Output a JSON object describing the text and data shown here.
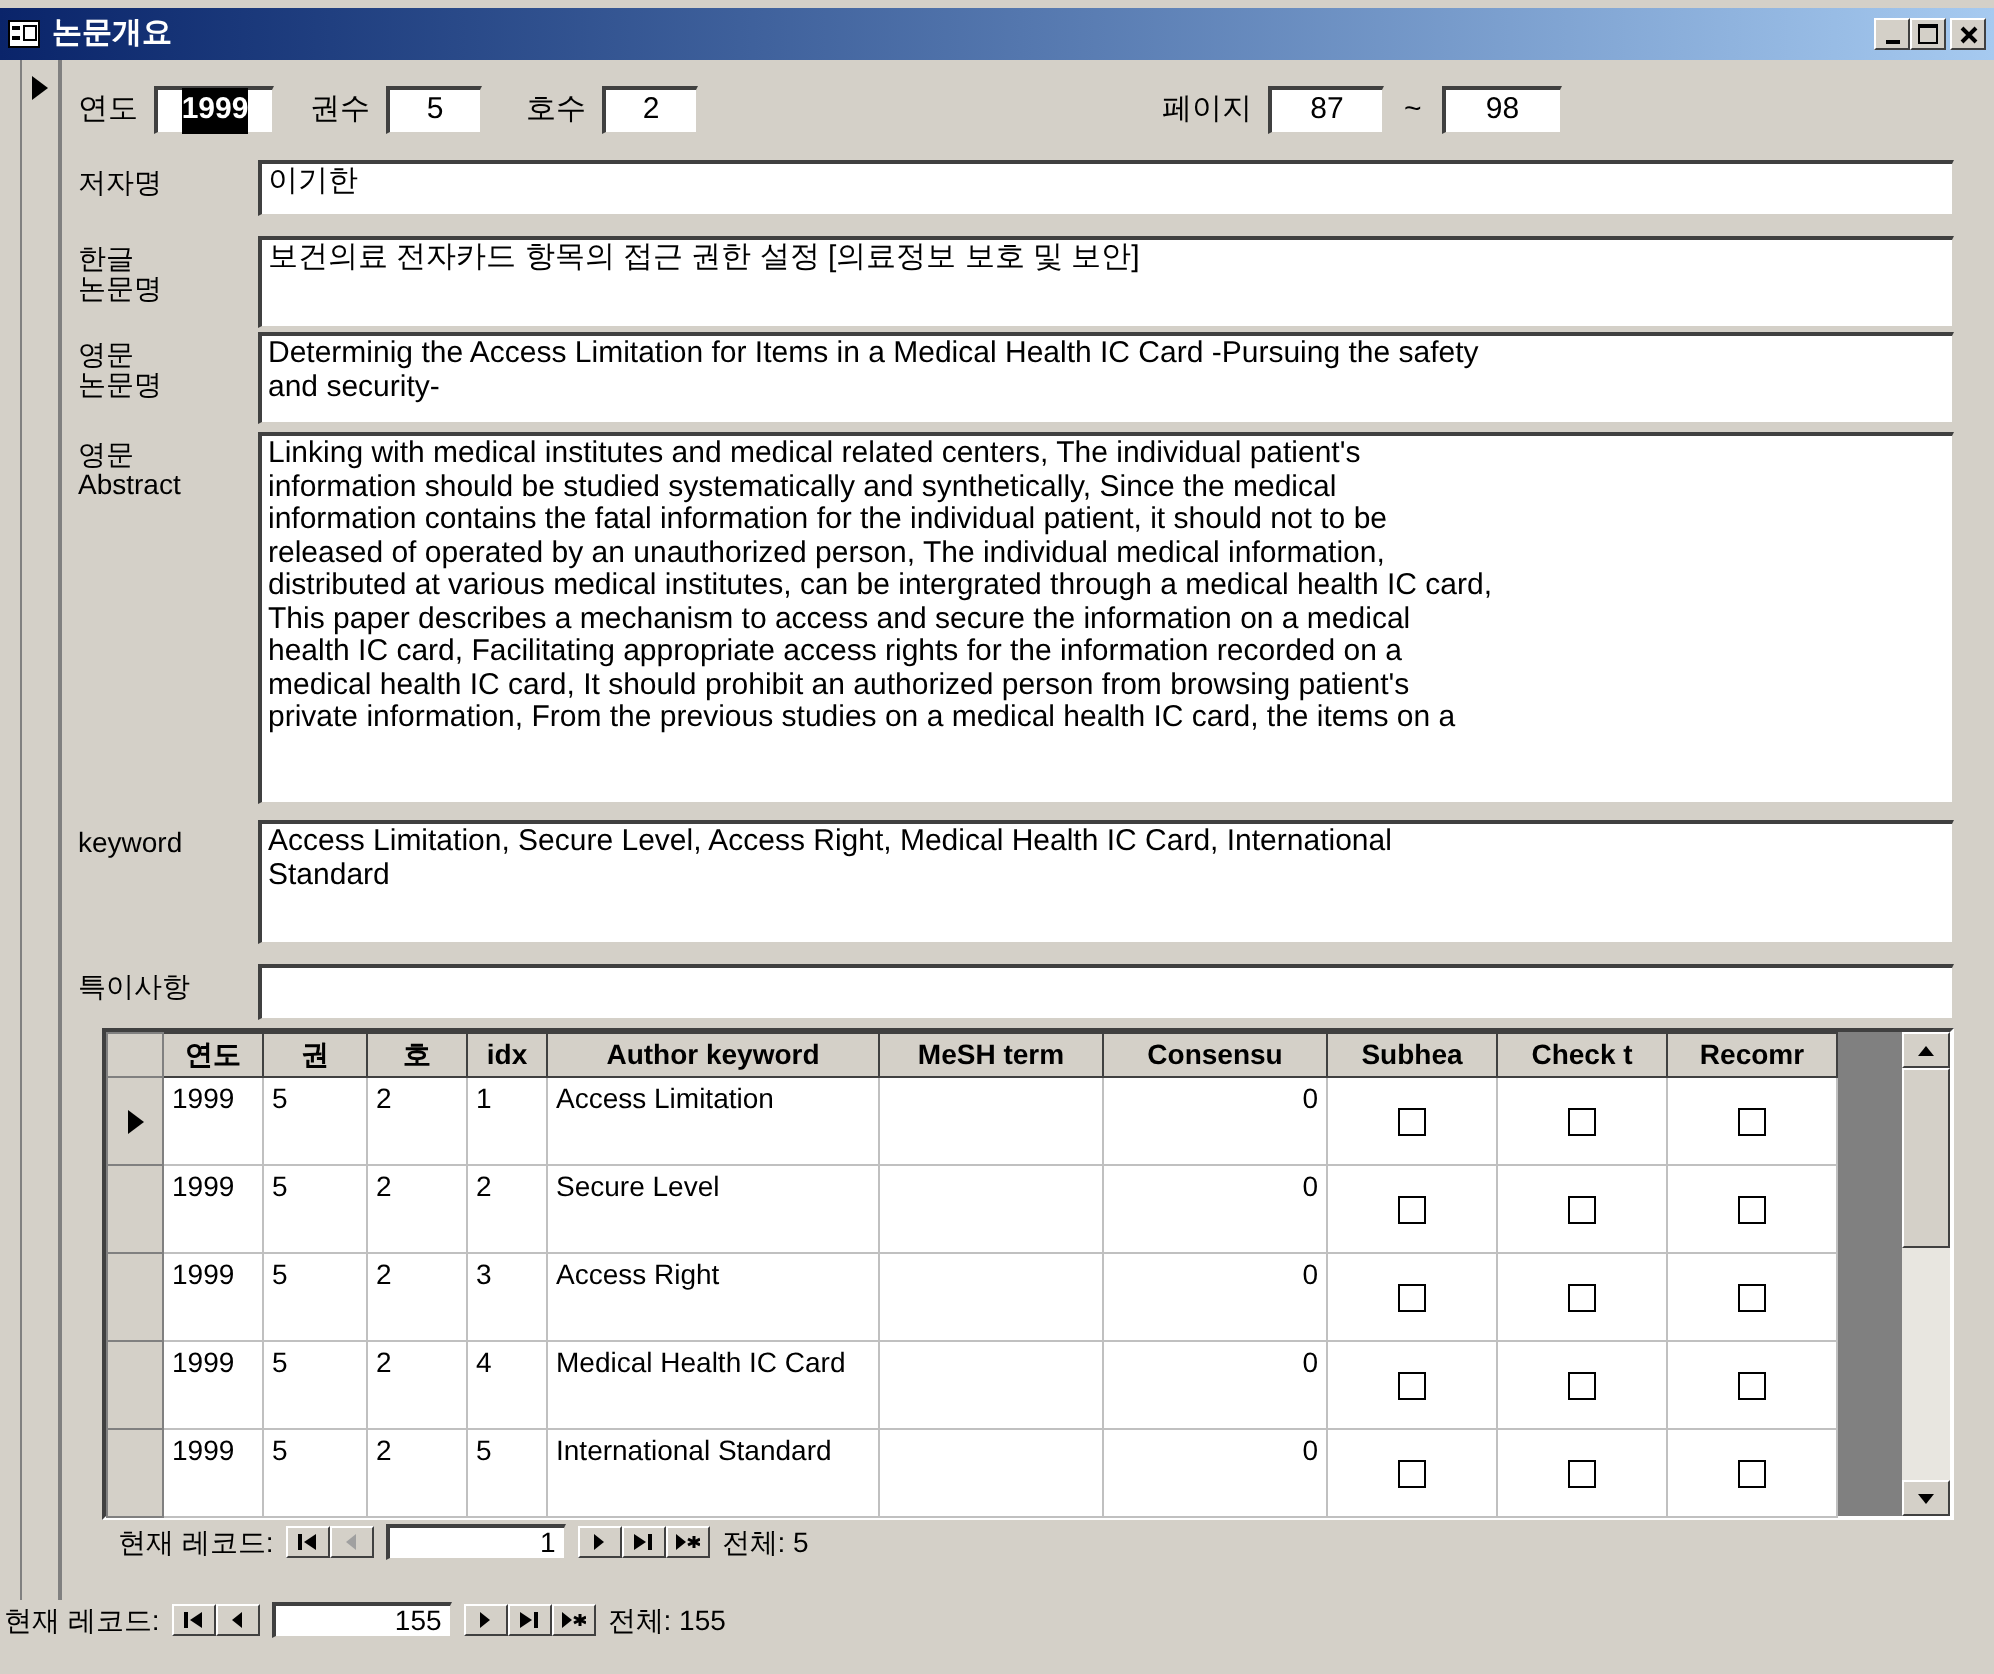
{
  "window": {
    "title": "논문개요"
  },
  "header": {
    "year": {
      "label": "연도",
      "value": "1999",
      "highlighted": true
    },
    "volume": {
      "label": "권수",
      "value": "5"
    },
    "issue": {
      "label": "호수",
      "value": "2"
    },
    "pages": {
      "label": "페이지",
      "from": "87",
      "separator": "~",
      "to": "98"
    }
  },
  "fields": [
    {
      "label_lines": [
        "저자명"
      ],
      "lines": [
        "이기한"
      ],
      "kind": "single"
    },
    {
      "label_lines": [
        "한글",
        "논문명"
      ],
      "lines": [
        "보건의료 전자카드 항목의 접근 권한 설정 [의료정보 보호 및 보안]"
      ],
      "kind": "title"
    },
    {
      "label_lines": [
        "영문",
        "논문명"
      ],
      "lines": [
        "Determinig the Access Limitation for Items in a Medical Health IC Card -Pursuing the safety",
        "and security-"
      ],
      "kind": "title"
    },
    {
      "label_lines": [
        "영문",
        "Abstract"
      ],
      "lines": [
        "Linking with medical institutes and medical related centers, The individual patient's",
        "information should be studied systematically and synthetically, Since the medical",
        "information contains the fatal information for the individual patient, it should not to be",
        "released of operated by an unauthorized person, The individual medical information,",
        "distributed at various medical institutes, can be intergrated through a medical health IC card,",
        "This paper describes a mechanism to access and secure the information on a medical",
        "health IC card, Facilitating appropriate access rights for the information recorded on a",
        "medical health IC card, It should prohibit an authorized person from browsing patient's",
        "private information, From the previous studies on a medical health IC card, the items on a"
      ],
      "kind": "abstract"
    },
    {
      "label_lines": [
        "keyword"
      ],
      "lines": [
        "Access Limitation, Secure Level, Access Right, Medical Health IC Card, International",
        "Standard"
      ],
      "kind": "keyword"
    },
    {
      "label_lines": [
        "특이사항"
      ],
      "kind": "single"
    }
  ],
  "grid": {
    "columns": [
      "연도",
      "권",
      "호",
      "idx",
      "Author keyword",
      "MeSH term",
      "Consensu",
      "Subhea",
      "Check t",
      "Recomr"
    ],
    "rows": [
      {
        "selected": true,
        "cells": [
          "1999",
          "5",
          "2",
          "1",
          "Access Limitation",
          "",
          "0"
        ],
        "checks": [
          false,
          false,
          false
        ]
      },
      {
        "selected": false,
        "cells": [
          "1999",
          "5",
          "2",
          "2",
          "Secure Level",
          "",
          "0"
        ],
        "checks": [
          false,
          false,
          false
        ]
      },
      {
        "selected": false,
        "cells": [
          "1999",
          "5",
          "2",
          "3",
          "Access Right",
          "",
          "0"
        ],
        "checks": [
          false,
          false,
          false
        ]
      },
      {
        "selected": false,
        "cells": [
          "1999",
          "5",
          "2",
          "4",
          "Medical Health IC Card",
          "",
          "0"
        ],
        "checks": [
          false,
          false,
          false
        ]
      },
      {
        "selected": false,
        "cells": [
          "1999",
          "5",
          "2",
          "5",
          "International Standard",
          "",
          "0"
        ],
        "checks": [
          false,
          false,
          false
        ]
      }
    ]
  },
  "navigators": [
    {
      "label": "현재 레코드:",
      "record": "1",
      "total": "전체: 5",
      "buttons": [
        {
          "kind": "first",
          "disabled": false
        },
        {
          "kind": "prev",
          "disabled": true
        },
        {
          "kind": "next",
          "disabled": false
        },
        {
          "kind": "last",
          "disabled": false
        },
        {
          "kind": "new",
          "disabled": false
        }
      ]
    },
    {
      "label": "현재 레코드:",
      "record": "155",
      "total": "전체: 155",
      "buttons": [
        {
          "kind": "first",
          "disabled": false
        },
        {
          "kind": "prev",
          "disabled": false
        },
        {
          "kind": "next",
          "disabled": false
        },
        {
          "kind": "last",
          "disabled": false
        },
        {
          "kind": "new",
          "disabled": false
        }
      ]
    }
  ]
}
